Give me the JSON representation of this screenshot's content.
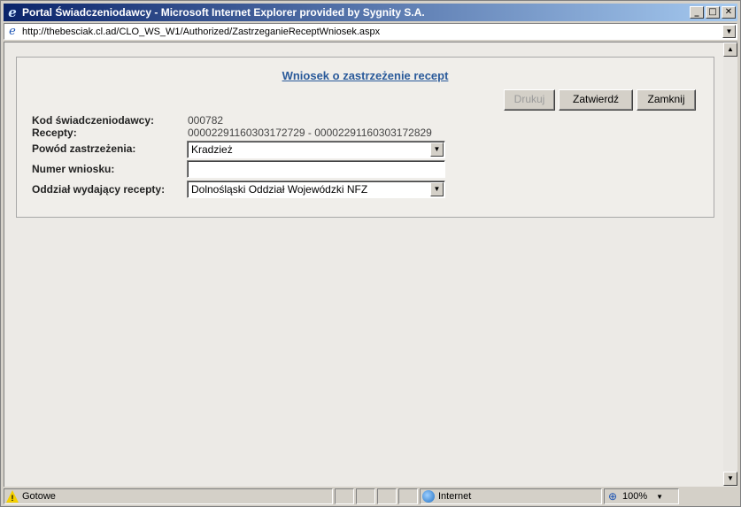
{
  "window": {
    "title": "Portal Świadczeniodawcy - Microsoft Internet Explorer provided by Sygnity S.A.",
    "minimize": "_",
    "maximize": "□",
    "close": "✕"
  },
  "address": {
    "url": "http://thebesciak.cl.ad/CLO_WS_W1/Authorized/ZastrzeganieReceptWniosek.aspx"
  },
  "form": {
    "title": "Wniosek o zastrzeżenie recept",
    "buttons": {
      "print": "Drukuj",
      "confirm": "Zatwierdź",
      "close": "Zamknij"
    },
    "fields": {
      "provider_code_label": "Kod świadczeniodawcy:",
      "provider_code_value": "000782",
      "prescriptions_label": "Recepty:",
      "prescriptions_value": "00002291160303172729 - 00002291160303172829",
      "reason_label": "Powód zastrzeżenia:",
      "reason_value": "Kradzież",
      "request_number_label": "Numer wniosku:",
      "request_number_value": "",
      "branch_label": "Oddział wydający recepty:",
      "branch_value": "Dolnośląski Oddział Wojewódzki NFZ"
    }
  },
  "statusbar": {
    "status": "Gotowe",
    "zone": "Internet",
    "zoom": "100%"
  },
  "icons": {
    "ie": "internet-explorer-icon",
    "page": "page-icon",
    "warning": "warning-icon",
    "globe": "globe-icon",
    "zoom": "zoom-icon"
  }
}
